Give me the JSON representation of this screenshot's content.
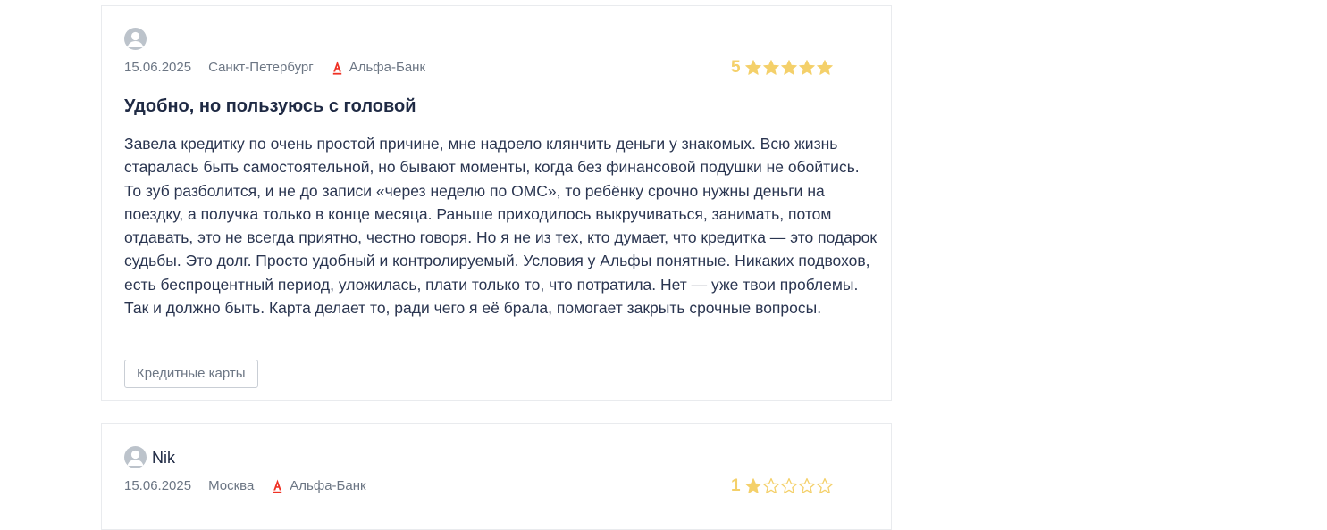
{
  "reviews": [
    {
      "author": "",
      "date": "15.06.2025",
      "city": "Санкт-Петербург",
      "bank": "Альфа-Банк",
      "rating": 5,
      "rating_label": "5",
      "title": "Удобно, но пользуюсь с головой",
      "text": "Завела кредитку по очень простой причине, мне надоело клянчить деньги у знакомых. Всю жизнь старалась быть самостоятельной, но бывают моменты, когда без финансовой подушки не обойтись. То зуб разболится, и не до записи «через неделю по ОМС», то ребёнку срочно нужны деньги на поездку, а получка только в конце месяца. Раньше приходилось выкручиваться, занимать, потом отдавать, это не всегда приятно, честно говоря. Но я не из тех, кто думает, что кредитка — это подарок судьбы. Это долг. Просто удобный и контролируемый. Условия у Альфы понятные. Никаких подвохов, есть беспроцентный период, уложилась, плати только то, что потратила. Нет — уже твои проблемы. Так и должно быть. Карта делает то, ради чего я её брала, помогает закрыть срочные вопросы.",
      "tag": "Кредитные карты"
    },
    {
      "author": "Nik",
      "date": "15.06.2025",
      "city": "Москва",
      "bank": "Альфа-Банк",
      "rating": 1,
      "rating_label": "1"
    }
  ],
  "colors": {
    "star": "#f4d06a",
    "alfa_red": "#ef3124",
    "avatar": "#bcc3cb"
  },
  "icons": {
    "avatar": "user-avatar-icon",
    "bank_logo": "alfa-bank-logo-icon",
    "star_full": "star-filled-icon",
    "star_empty": "star-outline-icon"
  }
}
